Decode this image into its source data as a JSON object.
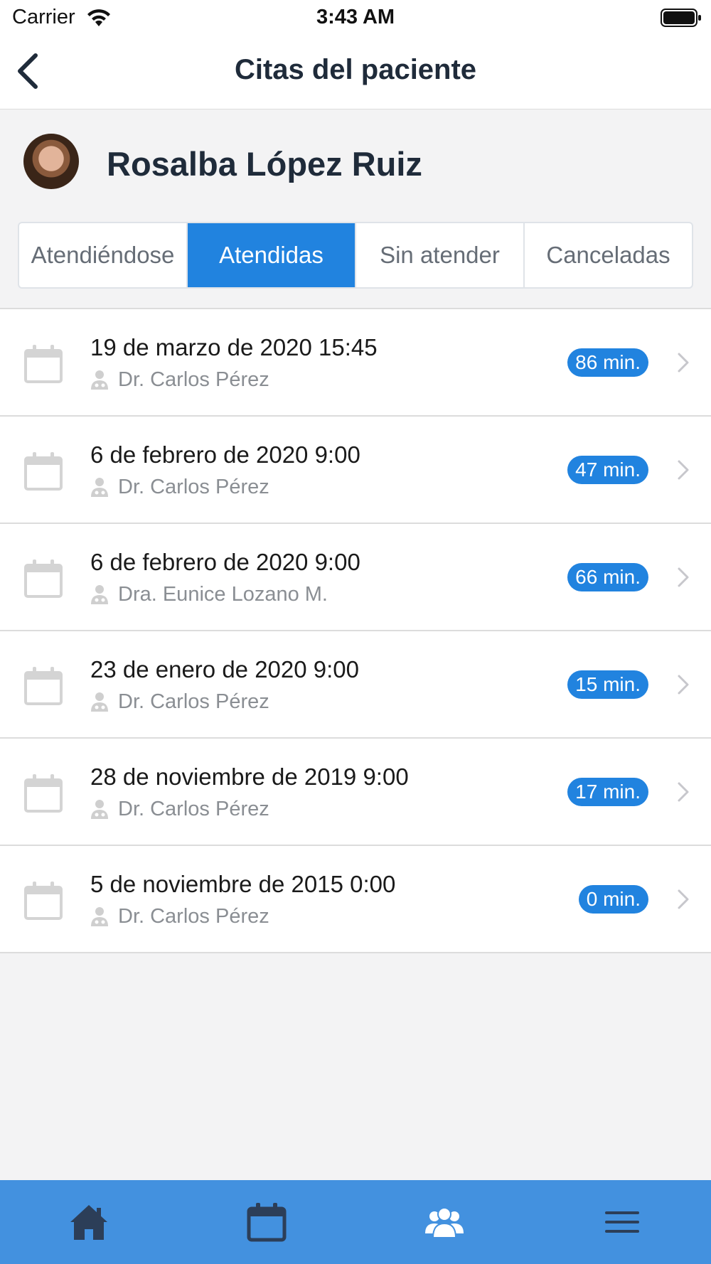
{
  "status_bar": {
    "carrier": "Carrier",
    "time": "3:43 AM"
  },
  "nav": {
    "title": "Citas del paciente",
    "back_icon": "chevron-left-icon"
  },
  "patient": {
    "name": "Rosalba López Ruiz"
  },
  "segments": [
    {
      "label": "Atendiéndose",
      "active": false
    },
    {
      "label": "Atendidas",
      "active": true
    },
    {
      "label": "Sin atender",
      "active": false
    },
    {
      "label": "Canceladas",
      "active": false
    }
  ],
  "appointments": [
    {
      "date": "19 de marzo de 2020 15:45",
      "doctor": "Dr. Carlos Pérez",
      "duration": "86 min."
    },
    {
      "date": "6 de febrero de 2020 9:00",
      "doctor": "Dr. Carlos Pérez",
      "duration": "47 min."
    },
    {
      "date": "6 de febrero de 2020 9:00",
      "doctor": "Dra. Eunice Lozano M.",
      "duration": "66 min."
    },
    {
      "date": "23 de enero de 2020 9:00",
      "doctor": "Dr. Carlos Pérez",
      "duration": "15 min."
    },
    {
      "date": "28 de noviembre de 2019 9:00",
      "doctor": "Dr. Carlos Pérez",
      "duration": "17 min."
    },
    {
      "date": "5 de noviembre de 2015 0:00",
      "doctor": "Dr. Carlos Pérez",
      "duration": "0 min."
    }
  ],
  "tabs": [
    {
      "icon": "home-icon"
    },
    {
      "icon": "calendar-icon"
    },
    {
      "icon": "patients-icon"
    },
    {
      "icon": "menu-icon"
    }
  ],
  "colors": {
    "accent": "#2183df",
    "tab_bar": "#4391df",
    "tab_icon": "#2c3e58",
    "tab_icon_active": "#ffffff",
    "background": "#f3f3f4"
  }
}
